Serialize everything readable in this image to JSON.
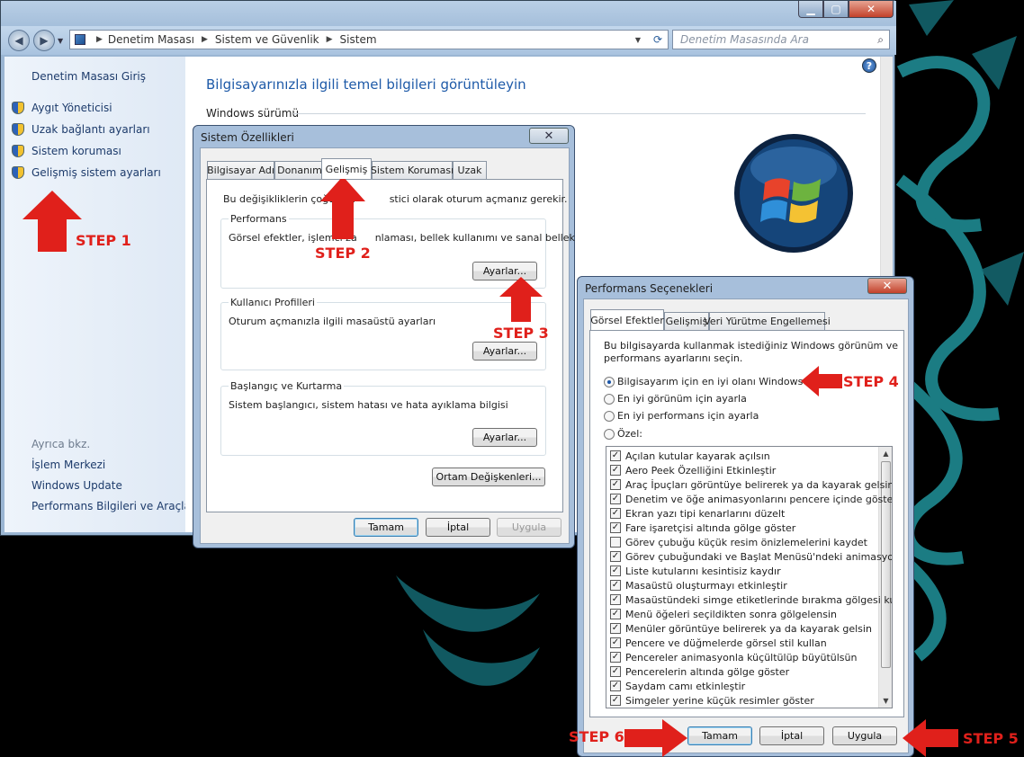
{
  "explorer": {
    "breadcrumb": [
      "Denetim Masası",
      "Sistem ve Güvenlik",
      "Sistem"
    ],
    "search_placeholder": "Denetim Masasında Ara",
    "left_home": "Denetim Masası Giriş",
    "left_links": [
      "Aygıt Yöneticisi",
      "Uzak bağlantı ayarları",
      "Sistem koruması",
      "Gelişmiş sistem ayarları"
    ],
    "see_also_heading": "Ayrıca bkz.",
    "see_also_links": [
      "İşlem Merkezi",
      "Windows Update",
      "Performans Bilgileri ve Araçları"
    ],
    "page_heading": "Bilgisayarınızla ilgili temel bilgileri görüntüleyin",
    "section_windows_edition": "Windows sürümü"
  },
  "sysprops": {
    "title": "Sistem Özellikleri",
    "tabs": [
      "Bilgisayar Adı",
      "Donanım",
      "Gelişmiş",
      "Sistem Koruması",
      "Uzak"
    ],
    "intro": "Bu değişikliklerin çoğu için yönetici olarak oturum açmanız gerekir.",
    "intro_visible": "Bu değişikliklerin çoğu için",
    "intro_visible_end": "stici olarak oturum açmanız gerekir.",
    "perf_label": "Performans",
    "perf_desc_start": "Görsel efektler, işlemci za",
    "perf_desc_end": "nlaması, bellek kullanımı ve sanal bellek",
    "profiles_label": "Kullanıcı Profilleri",
    "profiles_desc": "Oturum açmanızla ilgili masaüstü ayarları",
    "startup_label": "Başlangıç ve Kurtarma",
    "startup_desc": "Sistem başlangıcı, sistem hatası ve hata ayıklama bilgisi",
    "settings_btn": "Ayarlar...",
    "env_btn": "Ortam Değişkenleri...",
    "ok": "Tamam",
    "cancel": "İptal",
    "apply": "Uygula"
  },
  "perfopts": {
    "title": "Performans Seçenekleri",
    "tabs": [
      "Görsel Efektler",
      "Gelişmiş",
      "Veri Yürütme Engellemesi"
    ],
    "intro_line1": "Bu bilgisayarda kullanmak istediğiniz Windows görünüm ve",
    "intro_line2": "performans ayarlarını seçin.",
    "radios": [
      {
        "label": "Bilgisayarım için en iyi olanı Windows seçsin",
        "selected": true
      },
      {
        "label": "En iyi görünüm için ayarla",
        "selected": false
      },
      {
        "label": "En iyi performans için ayarla",
        "selected": false
      },
      {
        "label": "Özel:",
        "selected": false
      }
    ],
    "checks": [
      {
        "label": "Açılan kutular kayarak açılsın",
        "checked": true
      },
      {
        "label": "Aero Peek Özelliğini Etkinleştir",
        "checked": true
      },
      {
        "label": "Araç İpuçları görüntüye belirerek ya da kayarak gelsin",
        "checked": true
      },
      {
        "label": "Denetim ve öğe animasyonlarını pencere içinde göster",
        "checked": true
      },
      {
        "label": "Ekran yazı tipi kenarlarını düzelt",
        "checked": true
      },
      {
        "label": "Fare işaretçisi altında gölge göster",
        "checked": true
      },
      {
        "label": "Görev çubuğu küçük resim önizlemelerini kaydet",
        "checked": false
      },
      {
        "label": "Görev çubuğundaki ve Başlat Menüsü'ndeki animasyonlar",
        "checked": true
      },
      {
        "label": "Liste kutularını kesintisiz kaydır",
        "checked": true
      },
      {
        "label": "Masaüstü oluşturmayı etkinleştir",
        "checked": true
      },
      {
        "label": "Masaüstündeki simge etiketlerinde bırakma gölgesi kullan",
        "checked": true
      },
      {
        "label": "Menü öğeleri seçildikten sonra gölgelensin",
        "checked": true
      },
      {
        "label": "Menüler görüntüye belirerek ya da kayarak gelsin",
        "checked": true
      },
      {
        "label": "Pencere ve düğmelerde görsel stil kullan",
        "checked": true
      },
      {
        "label": "Pencereler animasyonla küçültülüp büyütülsün",
        "checked": true
      },
      {
        "label": "Pencerelerin altında gölge göster",
        "checked": true
      },
      {
        "label": "Saydam camı etkinleştir",
        "checked": true
      },
      {
        "label": "Simgeler yerine küçük resimler göster",
        "checked": true
      }
    ],
    "ok": "Tamam",
    "cancel": "İptal",
    "apply": "Uygula"
  },
  "steps": [
    "STEP 1",
    "STEP 2",
    "STEP 3",
    "STEP 4",
    "STEP 5",
    "STEP 6"
  ],
  "colors": {
    "step_red": "#e0201b",
    "link_blue": "#1d3b6b",
    "heading_blue": "#1e5aa8"
  }
}
